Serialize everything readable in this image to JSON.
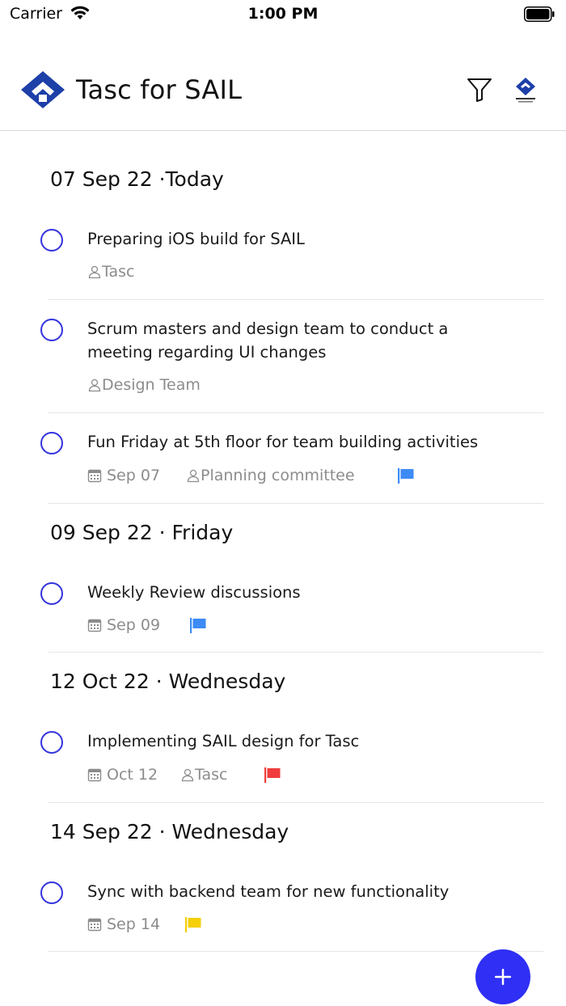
{
  "status_bar": {
    "carrier": "Carrier",
    "time": "1:00 PM"
  },
  "header": {
    "title": "Tasc for SAIL",
    "filter_icon": "filter-icon",
    "profile_icon": "sail-logo-icon"
  },
  "colors": {
    "accent": "#3333DD",
    "fab": "#2F2FF5",
    "flag_blue": "#3D8BF5",
    "flag_red": "#F03C3C",
    "flag_yellow": "#F5CF0A",
    "meta_text": "#8C8C8C"
  },
  "sections": [
    {
      "header": "07 Sep 22 ·Today",
      "tasks": [
        {
          "title": "Preparing iOS build for SAIL",
          "assignee": "Tasc"
        },
        {
          "title": "Scrum masters and design team to conduct a meeting regarding UI changes",
          "assignee": "Design Team"
        },
        {
          "title": "Fun Friday at 5th floor for team building activities",
          "date": "Sep 07",
          "assignee": "Planning committee",
          "flag": "blue"
        }
      ]
    },
    {
      "header": "09 Sep 22 · Friday",
      "tasks": [
        {
          "title": "Weekly Review discussions",
          "date": "Sep 09",
          "flag": "blue"
        }
      ]
    },
    {
      "header": "12 Oct 22 · Wednesday",
      "tasks": [
        {
          "title": "Implementing SAIL design for Tasc",
          "date": "Oct 12",
          "assignee": "Tasc",
          "flag": "red"
        }
      ]
    },
    {
      "header": "14 Sep 22 · Wednesday",
      "tasks": [
        {
          "title": "Sync with backend team for new functionality",
          "date": "Sep 14",
          "flag": "yellow"
        }
      ]
    }
  ],
  "fab": {
    "icon": "plus-icon"
  }
}
